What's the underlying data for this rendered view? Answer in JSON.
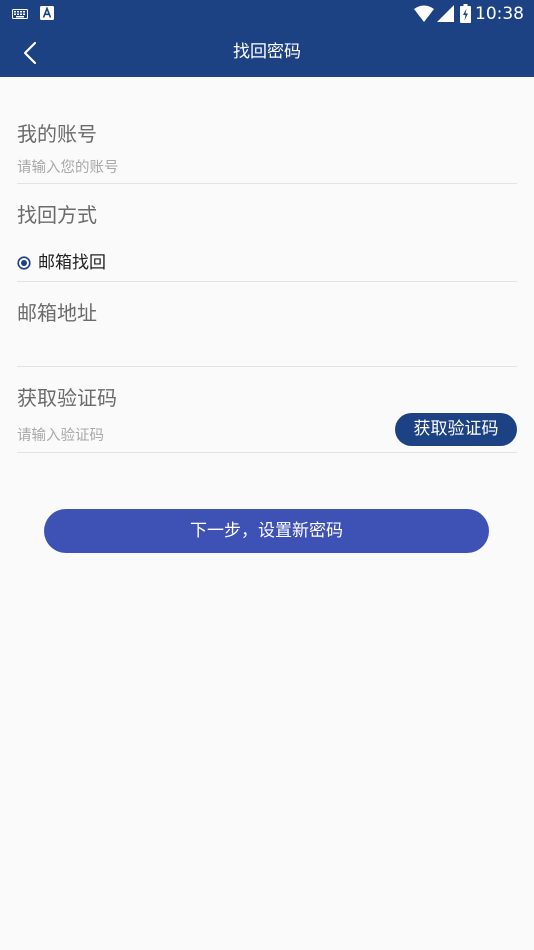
{
  "status_bar": {
    "time": "10:38",
    "icons": [
      "keyboard-icon",
      "a-notification-icon",
      "wifi-icon",
      "cell-signal-icon",
      "battery-charging-icon"
    ]
  },
  "app_bar": {
    "title": "找回密码",
    "back_icon": "chevron-left-icon"
  },
  "form": {
    "account": {
      "label": "我的账号",
      "value": "",
      "placeholder": "请输入您的账号"
    },
    "method": {
      "label": "找回方式",
      "options": [
        {
          "label": "邮箱找回",
          "selected": true
        }
      ]
    },
    "email": {
      "label": "邮箱地址",
      "value": "",
      "placeholder": ""
    },
    "code": {
      "label": "获取验证码",
      "value": "",
      "placeholder": "请输入验证码",
      "button_label": "获取验证码"
    }
  },
  "next_button": {
    "label": "下一步，设置新密码"
  },
  "colors": {
    "primary": "#1d4284",
    "button": "#3e51b4",
    "background": "#fafafa"
  }
}
